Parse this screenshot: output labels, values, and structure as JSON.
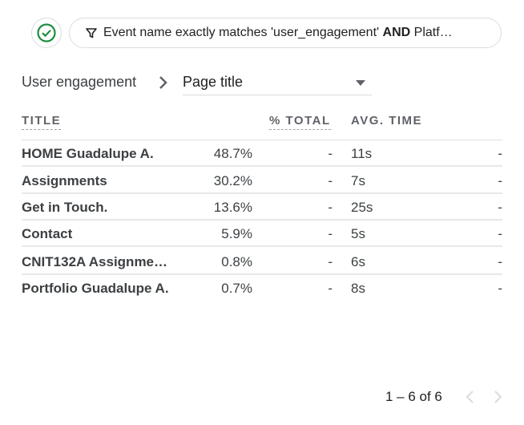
{
  "toolbar": {
    "check_icon": "check-circle-icon",
    "filter_icon": "filter-icon",
    "filter_text_prefix": "Event name exactly matches 'user_engagement' ",
    "filter_text_bold": "AND",
    "filter_text_suffix": " Platf…"
  },
  "breadcrumb": {
    "root": "User engagement",
    "dimension": "Page title"
  },
  "table": {
    "headers": {
      "title": "TITLE",
      "pct_total": "% TOTAL",
      "avg_time": "AVG. TIME"
    },
    "rows": [
      {
        "title": "HOME Guadalupe A.",
        "pct": "48.7%",
        "change1": "-",
        "time": "11s",
        "change2": "-"
      },
      {
        "title": "Assignments",
        "pct": "30.2%",
        "change1": "-",
        "time": "7s",
        "change2": "-"
      },
      {
        "title": "Get in Touch.",
        "pct": "13.6%",
        "change1": "-",
        "time": "25s",
        "change2": "-"
      },
      {
        "title": "Contact",
        "pct": "5.9%",
        "change1": "-",
        "time": "5s",
        "change2": "-"
      },
      {
        "title": "CNIT132A Assignme…",
        "pct": "0.8%",
        "change1": "-",
        "time": "6s",
        "change2": "-"
      },
      {
        "title": "Portfolio Guadalupe A.",
        "pct": "0.7%",
        "change1": "-",
        "time": "8s",
        "change2": "-"
      }
    ]
  },
  "pagination": {
    "label": "1 – 6 of 6"
  },
  "colors": {
    "check_green": "#1e8e3e",
    "disabled_chevron": "#dadce0"
  }
}
